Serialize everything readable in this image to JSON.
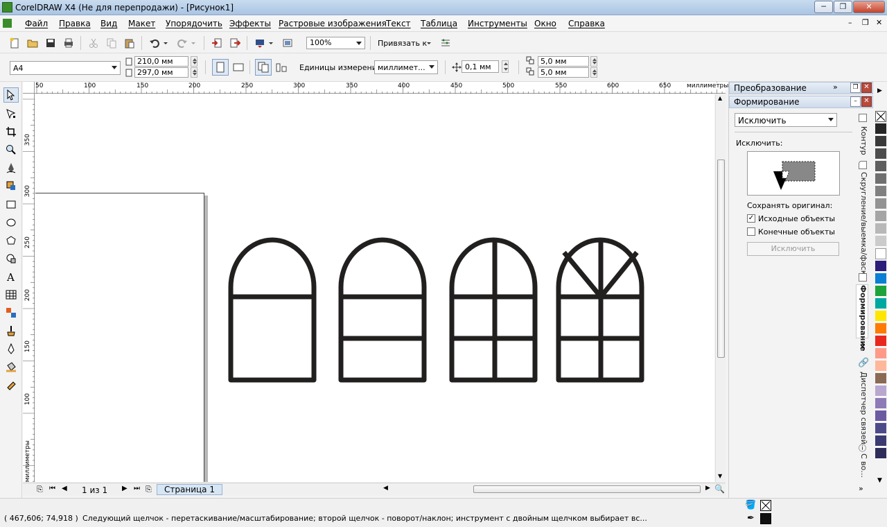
{
  "window": {
    "title": "CorelDRAW X4 (Не для перепродажи) - [Рисунок1]",
    "minimize": "─",
    "restore": "❐",
    "close": "✕"
  },
  "menu": [
    "Файл",
    "Правка",
    "Вид",
    "Макет",
    "Упорядочить",
    "Эффекты",
    "Растровые изображения",
    "Текст",
    "Таблица",
    "Инструменты",
    "Окно",
    "Справка"
  ],
  "standard_toolbar": {
    "zoom": "100%",
    "snap_label": "Привязать к"
  },
  "property_bar": {
    "page_size": "A4",
    "width": "210,0 мм",
    "height": "297,0 мм",
    "units_label": "Единицы измерения:",
    "units_value": "миллимет...",
    "nudge": "0,1 мм",
    "dup_x": "5,0 мм",
    "dup_y": "5,0 мм"
  },
  "rulers": {
    "horizontal_ticks": [
      "50",
      "100",
      "150",
      "200",
      "250",
      "300",
      "350",
      "400",
      "450",
      "500",
      "550",
      "600",
      "650"
    ],
    "horizontal_unit": "миллиметры",
    "vertical_ticks": [
      "350",
      "300",
      "250",
      "200",
      "150",
      "100"
    ],
    "vertical_unit": "миллиметры"
  },
  "canvas": {
    "stroke_color": "#221f1f"
  },
  "page_nav": {
    "position": "1 из 1",
    "page_tab": "Страница 1"
  },
  "docker": {
    "header1": "Преобразование",
    "header2": "Формирование",
    "mode_select": "Исключить",
    "section_label": "Исключить:",
    "keep_original_label": "Сохранять оригинал:",
    "source_objects": {
      "label": "Исходные объекты",
      "checked": true
    },
    "target_objects": {
      "label": "Конечные объекты",
      "checked": false
    },
    "apply_button": "Исключить",
    "tabs": [
      "Контур",
      "Скругление/выемка/фаска",
      "Формирование",
      "Диспетчер связей",
      "С во..."
    ]
  },
  "palette_colors": [
    "#262626",
    "#3a3a3a",
    "#4d4d4d",
    "#5e5e5e",
    "#6f6f6f",
    "#808080",
    "#939393",
    "#a5a5a5",
    "#b8b8b8",
    "#cbcbcb",
    "#ffffff",
    "#2b1d7a",
    "#0a7fd4",
    "#1ea33b",
    "#00a9a0",
    "#ffe600",
    "#ff7a00",
    "#e8281e",
    "#ff9a8a",
    "#ffb79a",
    "#8a6a55",
    "#b9a7cf",
    "#8f7ab8",
    "#6a5aa2",
    "#4d4a8a",
    "#3b3a72",
    "#2e2d5a"
  ],
  "status": {
    "coords": "( 467,606; 74,918 )",
    "hint": "Следующий щелчок - перетаскивание/масштабирование; второй щелчок - поворот/наклон; инструмент с двойным щелчком выбирает вс..."
  }
}
